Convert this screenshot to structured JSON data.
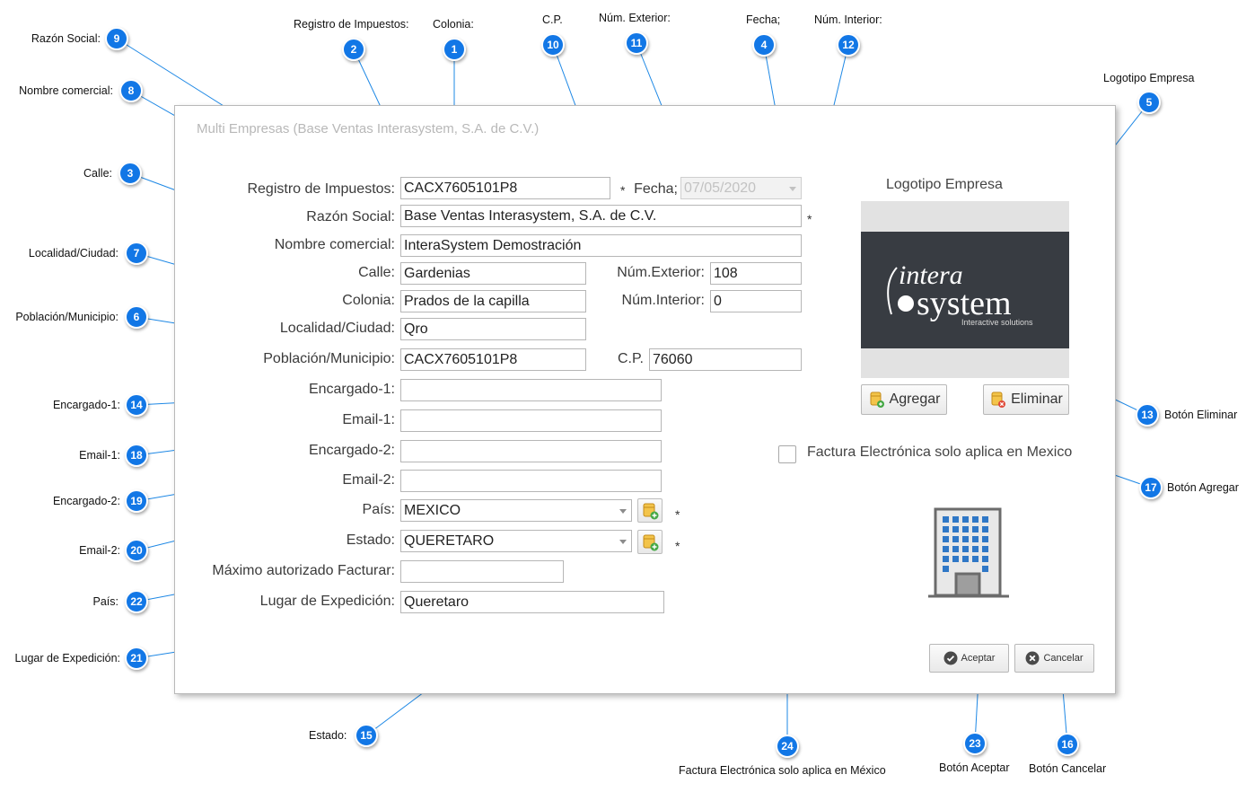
{
  "dialog": {
    "title": "Multi Empresas (Base Ventas Interasystem, S.A. de C.V.)",
    "fields": {
      "registro_label": "Registro de Impuestos:",
      "registro_value": "CACX7605101P8",
      "fecha_label": "Fecha;",
      "fecha_value": "07/05/2020",
      "razon_label": "Razón Social:",
      "razon_value": "Base Ventas Interasystem, S.A. de C.V.",
      "nombre_label": "Nombre comercial:",
      "nombre_value": "InteraSystem Demostración",
      "calle_label": "Calle:",
      "calle_value": "Gardenias",
      "num_ext_label": "Núm.Exterior:",
      "num_ext_value": "108",
      "colonia_label": "Colonia:",
      "colonia_value": "Prados de la capilla",
      "num_int_label": "Núm.Interior:",
      "num_int_value": "0",
      "localidad_label": "Localidad/Ciudad:",
      "localidad_value": "Qro",
      "poblacion_label": "Población/Municipio:",
      "poblacion_value": "CACX7605101P8",
      "cp_label": "C.P.",
      "cp_value": "76060",
      "encargado1_label": "Encargado-1:",
      "encargado1_value": "",
      "email1_label": "Email-1:",
      "email1_value": "",
      "encargado2_label": "Encargado-2:",
      "encargado2_value": "",
      "email2_label": "Email-2:",
      "email2_value": "",
      "pais_label": "País:",
      "pais_value": "MEXICO",
      "estado_label": "Estado:",
      "estado_value": "QUERETARO",
      "maximo_label": "Máximo autorizado Facturar:",
      "maximo_value": "",
      "lugar_label": "Lugar de Expedición:",
      "lugar_value": "Queretaro",
      "required_mark": "*"
    },
    "logo": {
      "label": "Logotipo Empresa",
      "brand_line1": "intera",
      "brand_line2": "system",
      "tagline": "Interactive solutions",
      "add_label": "Agregar",
      "remove_label": "Eliminar"
    },
    "checkbox_label": "Factura Electrónica solo aplica en Mexico",
    "accept_label": "Aceptar",
    "cancel_label": "Cancelar"
  },
  "callouts": [
    {
      "n": "1",
      "text": "Colonia:"
    },
    {
      "n": "2",
      "text": "Registro de Impuestos:"
    },
    {
      "n": "3",
      "text": "Calle:"
    },
    {
      "n": "4",
      "text": "Fecha;"
    },
    {
      "n": "5",
      "text": "Logotipo Empresa"
    },
    {
      "n": "6",
      "text": "Población/Municipio:"
    },
    {
      "n": "7",
      "text": "Localidad/Ciudad:"
    },
    {
      "n": "8",
      "text": "Nombre comercial:"
    },
    {
      "n": "9",
      "text": "Razón Social:"
    },
    {
      "n": "10",
      "text": "C.P."
    },
    {
      "n": "11",
      "text": "Núm. Exterior:"
    },
    {
      "n": "12",
      "text": "Núm. Interior:"
    },
    {
      "n": "13",
      "text": "Botón Eliminar"
    },
    {
      "n": "14",
      "text": "Encargado-1:"
    },
    {
      "n": "15",
      "text": "Estado:"
    },
    {
      "n": "16",
      "text": "Botón Cancelar"
    },
    {
      "n": "17",
      "text": "Botón Agregar"
    },
    {
      "n": "18",
      "text": "Email-1:"
    },
    {
      "n": "19",
      "text": "Encargado-2:"
    },
    {
      "n": "20",
      "text": "Email-2:"
    },
    {
      "n": "21",
      "text": "Lugar de Expedición:"
    },
    {
      "n": "22",
      "text": "País:"
    },
    {
      "n": "23",
      "text": "Botón Aceptar"
    },
    {
      "n": "24",
      "text": "Factura Electrónica solo aplica en México"
    }
  ],
  "colors": {
    "badge": "#1277e6",
    "leader_line": "#1e88e5",
    "logo_bg": "#383c42"
  }
}
